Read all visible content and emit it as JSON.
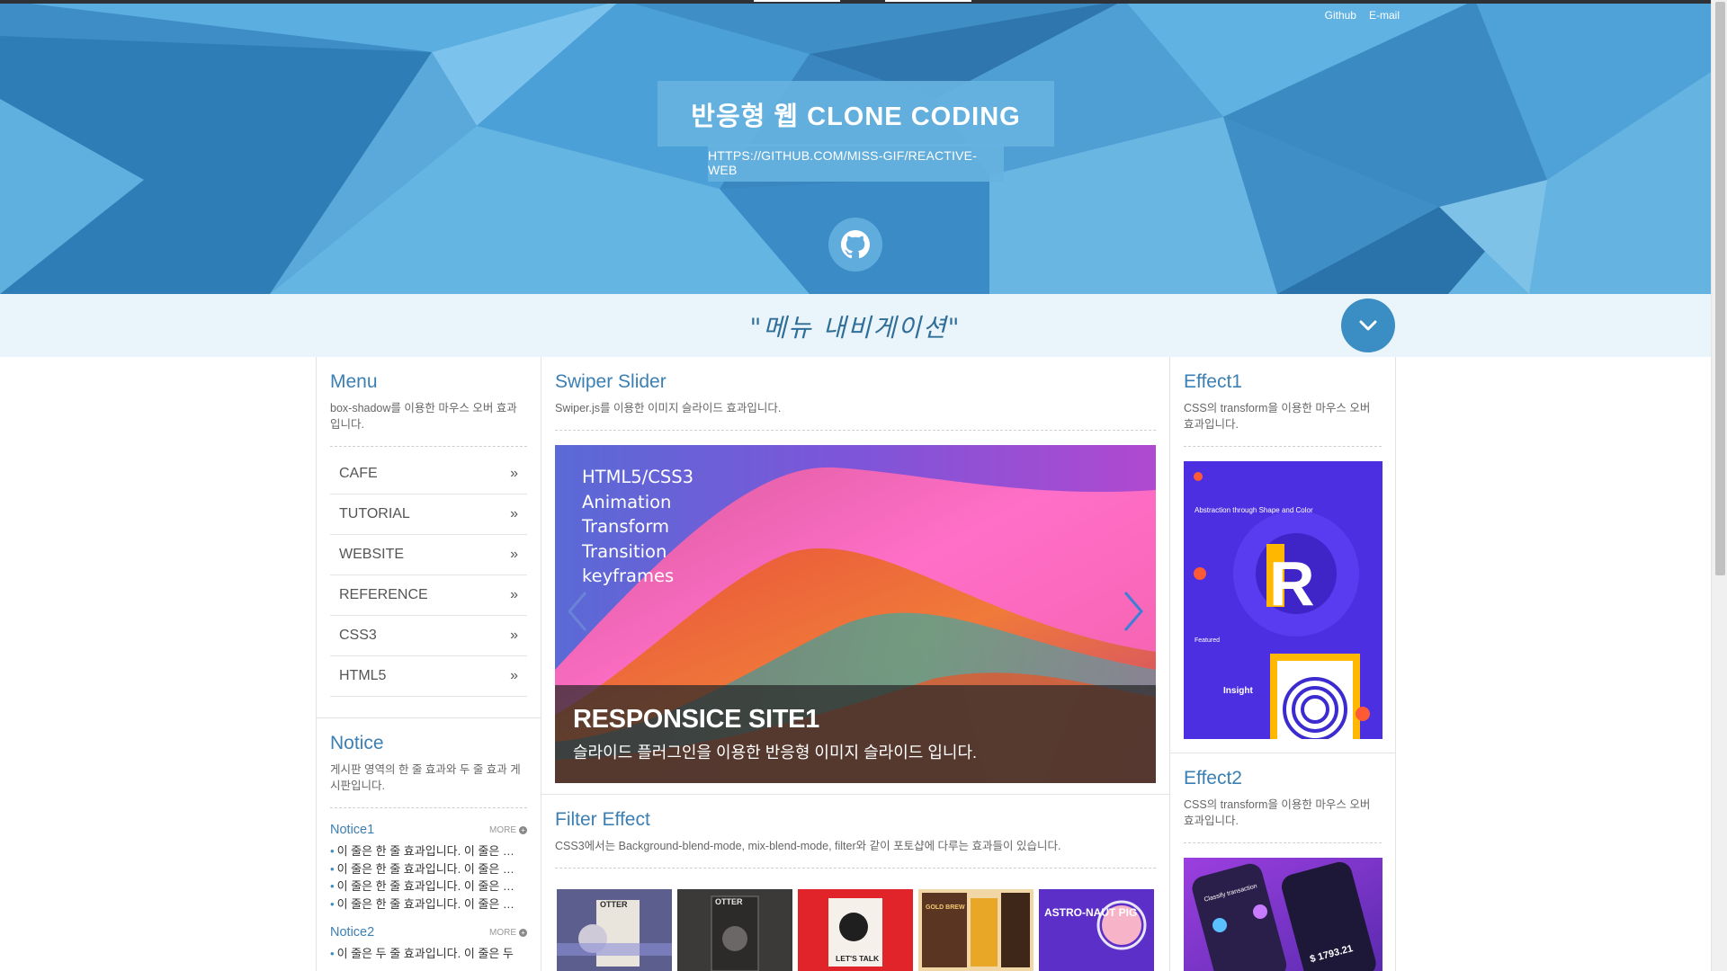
{
  "header": {
    "top_links": [
      "Github",
      "E-mail"
    ],
    "title": "반응형 웹 CLONE CODING",
    "url": "HTTPS://GITHUB.COM/MISS-GIF/REACTIVE-WEB",
    "github_icon": "github-icon"
  },
  "nav": {
    "title": "\"메뉴 내비게이션\"",
    "toggle_icon": "chevron-down-icon"
  },
  "menu": {
    "title": "Menu",
    "desc": "box-shadow를 이용한 마우스 오버 효과입니다.",
    "items": [
      {
        "label": "CAFE"
      },
      {
        "label": "TUTORIAL"
      },
      {
        "label": "WEBSITE"
      },
      {
        "label": "REFERENCE"
      },
      {
        "label": "CSS3"
      },
      {
        "label": "HTML5"
      }
    ],
    "item_icon": "double-chevron-right-icon"
  },
  "notice": {
    "title": "Notice",
    "desc": "게시판 영역의 한 줄 효과와 두 줄 효과 게시판입니다.",
    "boards": [
      {
        "name": "Notice1",
        "more": "MORE",
        "items": [
          "이 줄은 한 줄 효과입니다. 이 줄은 …",
          "이 줄은 한 줄 효과입니다. 이 줄은 …",
          "이 줄은 한 줄 효과입니다. 이 줄은 …",
          "이 줄은 한 줄 효과입니다. 이 줄은 …"
        ]
      },
      {
        "name": "Notice2",
        "more": "MORE",
        "items": [
          "이 줄은 두 줄 효과입니다. 이 줄은 두"
        ]
      }
    ]
  },
  "swiper": {
    "title": "Swiper Slider",
    "desc": "Swiper.js를 이용한 이미지 슬라이드 효과입니다.",
    "slide_lines": [
      "HTML5/CSS3",
      "Animation",
      "Transform",
      "Transition",
      "keyframes"
    ],
    "caption_title": "RESPONSICE SITE1",
    "caption_sub": "슬라이드 플러그인을 이용한 반응형 이미지 슬라이드 입니다."
  },
  "filter": {
    "title": "Filter Effect",
    "desc": "CSS3에서는 Background-blend-mode, mix-blend-mode, filter와 같이 포토샵에 다루는 효과들이 있습니다.",
    "thumbs": [
      {
        "text": "OTTER",
        "bg": "#5c5f8e"
      },
      {
        "text": "OTTER",
        "bg": "#3c3939"
      },
      {
        "text": "LET'S TALK",
        "bg": "#e0242a"
      },
      {
        "text": "GOLD BREW",
        "bg": "#7a4b33"
      },
      {
        "text": "ASTRO-NAUT PIG",
        "bg": "#5b2fc8"
      }
    ]
  },
  "effect1": {
    "title": "Effect1",
    "desc": "CSS의 transform을 이용한 마우스 오버 효과입니다.",
    "img_text_1": "Abstraction through Shape and Color",
    "img_text_2": "Featured",
    "img_text_3": "Insight"
  },
  "effect2": {
    "title": "Effect2",
    "desc": "CSS의 transform을 이용한 마우스 오버 효과입니다.",
    "img_text_1": "Classify transaction",
    "img_text_2": "$ 1793.21"
  },
  "colors": {
    "accent": "#3b7fb3",
    "hero": "#3f8fc6",
    "nav_bg": "#eaf4fb"
  }
}
